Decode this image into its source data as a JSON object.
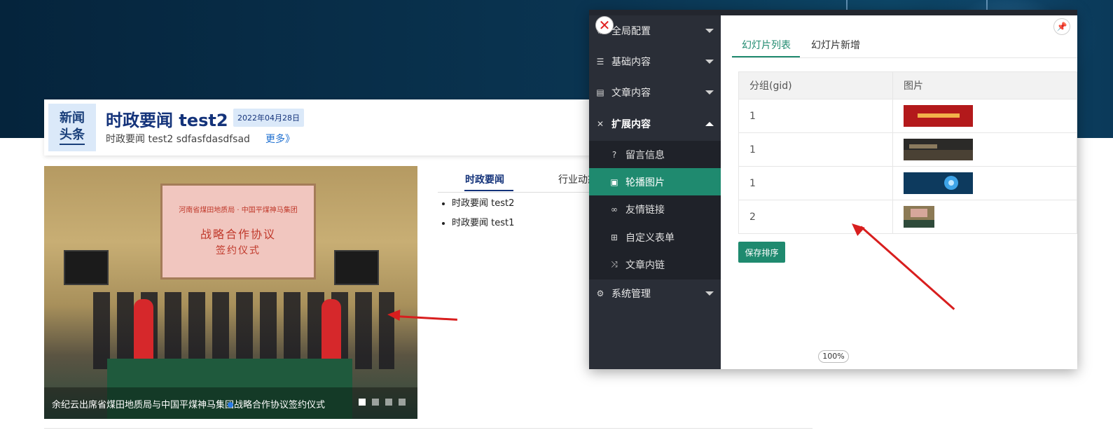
{
  "site": {
    "news_badge": [
      "新闻",
      "头条"
    ],
    "headline_title": "时政要闻 test2",
    "headline_date": "2022年04月28日",
    "headline_summary": "时政要闻 test2 sdfasfdasdfsad",
    "more_link": "更多》",
    "carousel": {
      "screen_line1": "河南省煤田地质局 · 中国平煤神马集团",
      "screen_line2": "战略合作协议",
      "screen_line3": "签约仪式",
      "caption": "余纪云出席省煤田地质局与中国平煤神马集团战略合作协议签约仪式",
      "slide_count": 4,
      "active_slide": 1
    },
    "tabs": [
      "时政要闻",
      "行业动态"
    ],
    "news_items": [
      "时政要闻 test2",
      "时政要闻 test1"
    ]
  },
  "admin": {
    "menu": [
      {
        "label": "全局配置",
        "icon": "gear-icon",
        "expanded": false
      },
      {
        "label": "基础内容",
        "icon": "sliders-icon",
        "expanded": false
      },
      {
        "label": "文章内容",
        "icon": "document-icon",
        "expanded": false
      },
      {
        "label": "扩展内容",
        "icon": "expand-icon",
        "expanded": true
      },
      {
        "label": "系统管理",
        "icon": "gear-icon",
        "expanded": false
      }
    ],
    "submenu": [
      {
        "label": "留言信息",
        "icon": "question-icon"
      },
      {
        "label": "轮播图片",
        "icon": "image-icon",
        "active": true
      },
      {
        "label": "友情链接",
        "icon": "link-icon"
      },
      {
        "label": "自定义表单",
        "icon": "plus-square-icon"
      },
      {
        "label": "文章内链",
        "icon": "shuffle-icon"
      }
    ],
    "tabs": [
      {
        "label": "幻灯片列表",
        "active": true
      },
      {
        "label": "幻灯片新增",
        "active": false
      }
    ],
    "table": {
      "columns": [
        "分组(gid)",
        "图片"
      ],
      "rows": [
        {
          "gid": "1",
          "thumb": "red-banner"
        },
        {
          "gid": "1",
          "thumb": "dusk-landscape"
        },
        {
          "gid": "1",
          "thumb": "blue-tech"
        },
        {
          "gid": "2",
          "thumb": "meeting-photo"
        }
      ]
    },
    "save_button": "保存排序",
    "zoom": "100%",
    "accent_color": "#1f8a6f"
  }
}
